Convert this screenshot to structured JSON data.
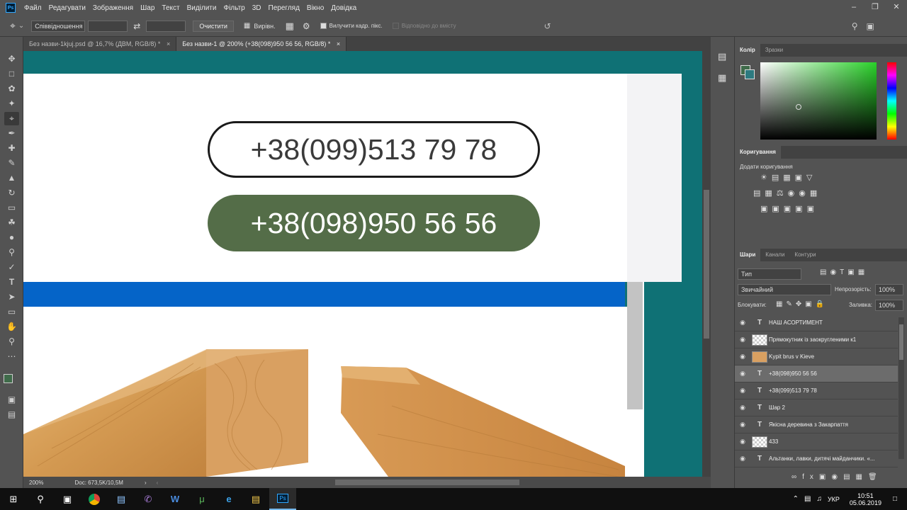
{
  "menubar": {
    "logo": "Ps",
    "items": [
      "Файл",
      "Редагувати",
      "Зображення",
      "Шар",
      "Текст",
      "Виділити",
      "Фільтр",
      "3D",
      "Перегляд",
      "Вікно",
      "Довідка"
    ]
  },
  "options": {
    "ratio": "Співвідношення",
    "clear": "Очистити",
    "straighten": "Вирівн.",
    "delete_cropped": "Вилучити кадр. пікс.",
    "content_aware": "Відповідно до вмісту"
  },
  "tabs": [
    {
      "label": "Без назви-1kjuj.psd @ 16,7% (ДВМ, RGB/8) *"
    },
    {
      "label": "Без назви-1 @ 200% (+38(098)950 56 56, RGB/8) *"
    }
  ],
  "canvas": {
    "phone1": "+38(099)513 79 78",
    "phone2": "+38(098)950 56 56"
  },
  "status": {
    "zoom": "200%",
    "doc": "Doc: 673,5K/10,5M"
  },
  "color_panel": {
    "tabs": [
      "Колір",
      "Зразки"
    ]
  },
  "adjust_panel": {
    "title": "Коригування",
    "subtitle": "Додати коригування"
  },
  "layers_panel": {
    "tabs": [
      "Шари",
      "Канали",
      "Контури"
    ],
    "filter": "Тип",
    "blend": "Звичайний",
    "opacity_label": "Непрозорість:",
    "opacity": "100%",
    "lock_label": "Блокувати:",
    "fill_label": "Заливка:",
    "fill": "100%",
    "layers": [
      {
        "type": "T",
        "name": "НАШ АСОРТИМЕНТ"
      },
      {
        "type": "img",
        "name": "Прямокутник із заокругленими к1"
      },
      {
        "type": "img",
        "name": "Kypit brus v Kieve"
      },
      {
        "type": "T",
        "name": "+38(098)950 56 56"
      },
      {
        "type": "T",
        "name": "+38(099)513 79 78"
      },
      {
        "type": "T",
        "name": "Шар 2"
      },
      {
        "type": "T",
        "name": "Якісна деревина  з Закарпаття"
      },
      {
        "type": "img",
        "name": "433"
      },
      {
        "type": "T",
        "name": "Альтанки, лавки, дитячі майданчики. «..."
      }
    ]
  },
  "taskbar": {
    "lang": "УКР",
    "time": "10:51",
    "date": "05.06.2019"
  },
  "colors": {
    "green_button": "#546d48",
    "teal_bg": "#0f7175",
    "blue_band": "#0564c8"
  }
}
